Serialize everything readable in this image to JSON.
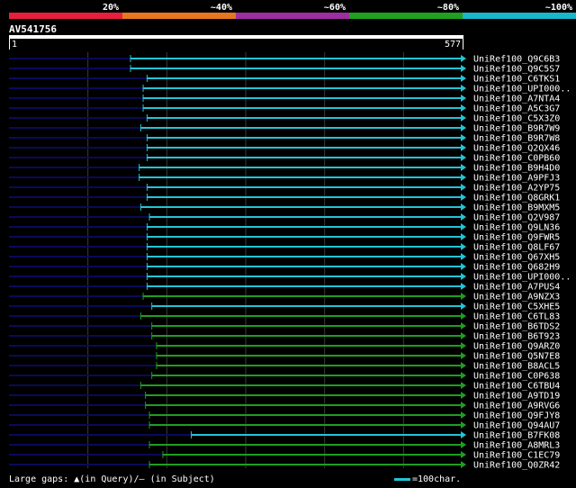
{
  "colors": {
    "background": "#000000",
    "identity_bands": [
      "#e81f3c",
      "#e8761f",
      "#9e2fa0",
      "#1fa01f",
      "#19b7c8"
    ],
    "rare_gap_line": "#0a0a5a",
    "grid": "#3a3a3a",
    "cyan": "#22c4d6",
    "green": "#1f9e1f"
  },
  "chart_data": {
    "type": "alignment",
    "title": "AV541756",
    "identity_legend": [
      "20%",
      "~40%",
      "~60%",
      "~80%",
      "~100%"
    ],
    "query_start_label": "1",
    "query_end_label": "577",
    "query_range": [
      1,
      577
    ],
    "hits": [
      {
        "name": "UniRef100_Q9C6B3",
        "start": 155,
        "end": 577,
        "color": "cyan"
      },
      {
        "name": "UniRef100_Q9C5S7",
        "start": 155,
        "end": 577,
        "color": "cyan"
      },
      {
        "name": "UniRef100_C6TKS1",
        "start": 176,
        "end": 577,
        "color": "cyan"
      },
      {
        "name": "UniRef100_UPI000..",
        "start": 171,
        "end": 577,
        "color": "cyan"
      },
      {
        "name": "UniRef100_A7NTA4",
        "start": 171,
        "end": 577,
        "color": "cyan"
      },
      {
        "name": "UniRef100_A5C3G7",
        "start": 171,
        "end": 577,
        "color": "cyan"
      },
      {
        "name": "UniRef100_C5X3Z0",
        "start": 176,
        "end": 577,
        "color": "cyan"
      },
      {
        "name": "UniRef100_B9R7W9",
        "start": 168,
        "end": 577,
        "color": "cyan"
      },
      {
        "name": "UniRef100_B9R7W8",
        "start": 176,
        "end": 577,
        "color": "cyan"
      },
      {
        "name": "UniRef100_Q2QX46",
        "start": 176,
        "end": 577,
        "color": "cyan"
      },
      {
        "name": "UniRef100_C0PB60",
        "start": 176,
        "end": 577,
        "color": "cyan"
      },
      {
        "name": "UniRef100_B9H4D0",
        "start": 166,
        "end": 577,
        "color": "cyan"
      },
      {
        "name": "UniRef100_A9PFJ3",
        "start": 166,
        "end": 577,
        "color": "cyan"
      },
      {
        "name": "UniRef100_A2YP75",
        "start": 176,
        "end": 577,
        "color": "cyan"
      },
      {
        "name": "UniRef100_Q8GRK1",
        "start": 176,
        "end": 577,
        "color": "cyan"
      },
      {
        "name": "UniRef100_B9MXM5",
        "start": 168,
        "end": 577,
        "color": "cyan"
      },
      {
        "name": "UniRef100_Q2V987",
        "start": 179,
        "end": 577,
        "color": "cyan"
      },
      {
        "name": "UniRef100_Q9LN36",
        "start": 176,
        "end": 577,
        "color": "cyan"
      },
      {
        "name": "UniRef100_Q9FWR5",
        "start": 176,
        "end": 577,
        "color": "cyan"
      },
      {
        "name": "UniRef100_Q8LF67",
        "start": 176,
        "end": 577,
        "color": "cyan"
      },
      {
        "name": "UniRef100_Q67XH5",
        "start": 176,
        "end": 577,
        "color": "cyan"
      },
      {
        "name": "UniRef100_Q682H9",
        "start": 176,
        "end": 577,
        "color": "cyan"
      },
      {
        "name": "UniRef100_UPI000..",
        "start": 176,
        "end": 577,
        "color": "cyan"
      },
      {
        "name": "UniRef100_A7PUS4",
        "start": 176,
        "end": 577,
        "color": "cyan"
      },
      {
        "name": "UniRef100_A9NZX3",
        "start": 171,
        "end": 577,
        "color": "green"
      },
      {
        "name": "UniRef100_C5XHE5",
        "start": 182,
        "end": 577,
        "color": "cyan"
      },
      {
        "name": "UniRef100_C6TL83",
        "start": 168,
        "end": 577,
        "color": "green"
      },
      {
        "name": "UniRef100_B6TDS2",
        "start": 182,
        "end": 577,
        "color": "green"
      },
      {
        "name": "UniRef100_B6T923",
        "start": 182,
        "end": 577,
        "color": "green"
      },
      {
        "name": "UniRef100_Q9ARZ0",
        "start": 188,
        "end": 577,
        "color": "green"
      },
      {
        "name": "UniRef100_Q5N7E8",
        "start": 188,
        "end": 577,
        "color": "green"
      },
      {
        "name": "UniRef100_B8ACL5",
        "start": 188,
        "end": 577,
        "color": "green"
      },
      {
        "name": "UniRef100_C0P638",
        "start": 182,
        "end": 577,
        "color": "green"
      },
      {
        "name": "UniRef100_C6TBU4",
        "start": 168,
        "end": 577,
        "color": "green"
      },
      {
        "name": "UniRef100_A9TD19",
        "start": 174,
        "end": 577,
        "color": "green"
      },
      {
        "name": "UniRef100_A9RVG6",
        "start": 174,
        "end": 577,
        "color": "green"
      },
      {
        "name": "UniRef100_Q9FJY8",
        "start": 179,
        "end": 577,
        "color": "green"
      },
      {
        "name": "UniRef100_Q94AU7",
        "start": 179,
        "end": 577,
        "color": "green"
      },
      {
        "name": "UniRef100_B7FK08",
        "start": 232,
        "end": 577,
        "color": "cyan"
      },
      {
        "name": "UniRef100_A8MRL3",
        "start": 179,
        "end": 577,
        "color": "green"
      },
      {
        "name": "UniRef100_C1EC79",
        "start": 196,
        "end": 577,
        "color": "green"
      },
      {
        "name": "UniRef100_Q0ZR42",
        "start": 179,
        "end": 577,
        "color": "green"
      }
    ]
  },
  "footer": {
    "large_gaps_label": "Large gaps: ",
    "in_query_marker": "▲",
    "in_query_label": "(in Query)/",
    "in_subject_marker": "—",
    "in_subject_label": " (in Subject)",
    "scale_label": "=100char."
  }
}
